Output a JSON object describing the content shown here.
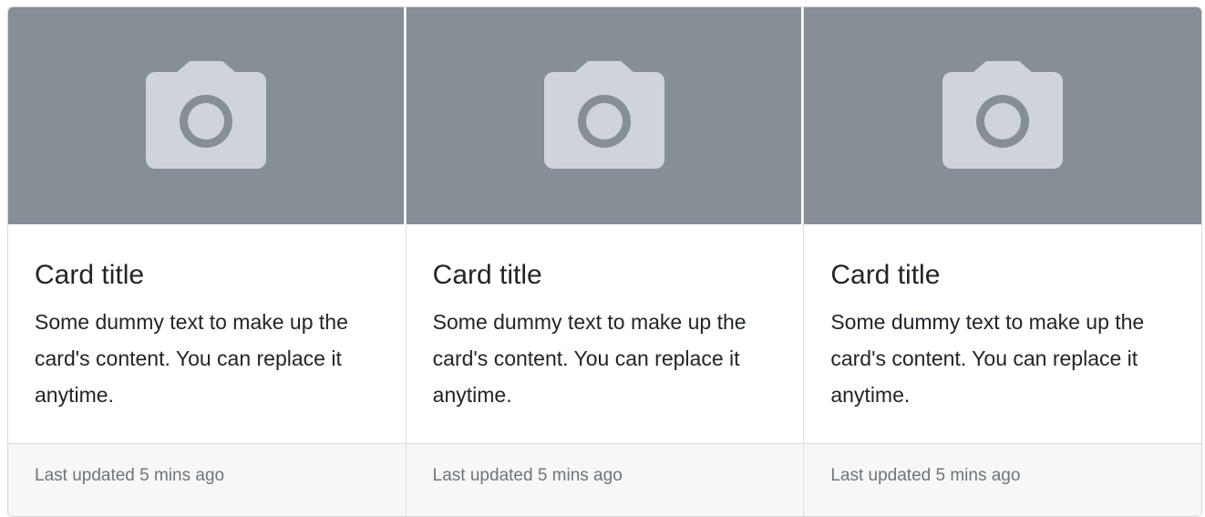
{
  "colors": {
    "image_placeholder_bg": "#868e96",
    "camera_icon": "#ced4da",
    "footer_bg": "#f7f7f7",
    "text": "#212529",
    "muted_text": "#6c757d"
  },
  "cards": [
    {
      "image_icon": "camera-icon",
      "title": "Card title",
      "text": "Some dummy text to make up the card's content. You can replace it anytime.",
      "footer": "Last updated 5 mins ago"
    },
    {
      "image_icon": "camera-icon",
      "title": "Card title",
      "text": "Some dummy text to make up the card's content. You can replace it anytime.",
      "footer": "Last updated 5 mins ago"
    },
    {
      "image_icon": "camera-icon",
      "title": "Card title",
      "text": "Some dummy text to make up the card's content. You can replace it anytime.",
      "footer": "Last updated 5 mins ago"
    }
  ]
}
